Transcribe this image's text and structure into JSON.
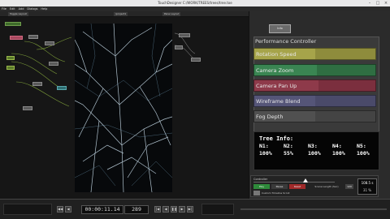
{
  "window": {
    "title": "TouchDesigner C:/WORK/TREES/trees/tree.toe"
  },
  "menu": [
    "File",
    "Edit",
    "Add",
    "Dialogs",
    "Help"
  ],
  "pathbar": {
    "left_btn": "Toggle Layout",
    "path": "/project1",
    "right_btn": "Pane Layout"
  },
  "panel": {
    "tab_label": "Info",
    "title": "Performance Controller",
    "bars": [
      {
        "label": "Rotation Speed",
        "color": "#8e8c3c",
        "fill": 0.5,
        "fill_color": "#a6a44a"
      },
      {
        "label": "Camera Zoom",
        "color": "#2f6e42",
        "fill": 0.52,
        "fill_color": "#3a8552"
      },
      {
        "label": "Camera Pan Up",
        "color": "#7b2f3e",
        "fill": 0.53,
        "fill_color": "#8e3a4a"
      },
      {
        "label": "Wireframe Blend",
        "color": "#4a4a6a",
        "fill": 0.5,
        "fill_color": "#555578"
      },
      {
        "label": "Fog Depth",
        "color": "#444444",
        "fill": 0.5,
        "fill_color": "#505050"
      }
    ],
    "tree_info": {
      "header": "Tree Info:",
      "names": [
        "N1:",
        "N2:",
        "N3:",
        "N4:",
        "N5:"
      ],
      "values": [
        "100%",
        "55%",
        "100%",
        "100%",
        "100%"
      ]
    }
  },
  "controller": {
    "label": "Controller",
    "play": "Play",
    "pause": "Pause",
    "reset": "Reset",
    "scene_length": "Scene Length (Sec)",
    "scene_length_value": "120",
    "custom_timeline": "Custom Timeline Scroll",
    "readout_top": "108.5 s",
    "readout_bottom": "31 %",
    "colors": {
      "play": "#2e8a3a",
      "reset": "#a02a2a"
    }
  },
  "timeline": {
    "timecode": "00:00:11.14",
    "frame": "289"
  }
}
